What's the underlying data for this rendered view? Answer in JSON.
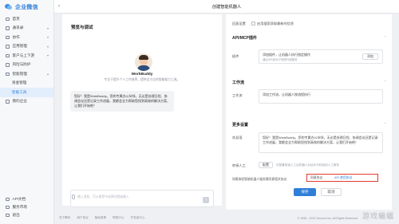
{
  "app": {
    "name": "企业微信"
  },
  "sidebar": {
    "items": [
      {
        "label": "首页",
        "icon": "home-icon"
      },
      {
        "label": "通讯录",
        "icon": "contacts-icon",
        "chev": "▾"
      },
      {
        "label": "协作",
        "icon": "collab-icon",
        "chev": "▾"
      },
      {
        "label": "应用管理",
        "icon": "apps-icon",
        "chev": "▾"
      },
      {
        "label": "客户与上下游",
        "icon": "customer-icon",
        "chev": "▾"
      },
      {
        "label": "风险与防护",
        "icon": "shield-icon"
      },
      {
        "label": "智能管理",
        "icon": "ai-icon",
        "chev": "▴"
      }
    ],
    "subitems": [
      "资金管理",
      "智能工具"
    ],
    "after": {
      "label": "我的企业",
      "icon": "company-icon"
    },
    "bottom": [
      {
        "label": "API文档",
        "icon": "doc-icon"
      },
      {
        "label": "服务市场",
        "icon": "market-icon"
      },
      {
        "label": "退出",
        "icon": "logout-icon"
      }
    ]
  },
  "header": {
    "title": "创建智能机器人",
    "back": "‹"
  },
  "preview": {
    "title": "预览与调试",
    "bot_name": "WorkBuddy",
    "bot_desc": "专注于提升个人工作效率，提供全方位的智能助力工具。",
    "greeting": "您好！我是WorkBuddy，您的专属办公伙伴。无论是处理日程、协调会议还是记录工作进展，我都会全力帮助您找到高效的解决方案，让我们开始吧！",
    "input_placeholder": "输入消息，可从推荐中选择问题或输入",
    "send": "↑"
  },
  "form": {
    "top_label": "回复设置",
    "top_option": "启用搜索获取最新的信息",
    "api_section": "API/MCP插件",
    "plugin_label": "插件",
    "plugin_value": "添加插件，让机器人执行指定操作",
    "plugin_sub": "通过API或MCP调用外部服务",
    "add_button": "添加",
    "workflow_section": "工作流",
    "workflow_label": "工作流",
    "workflow_value": "添加工作流，让机器人按流程执行",
    "more_section": "更多设置",
    "welcome_label": "欢迎语",
    "welcome_value": "您好！我是WorkBuddy，您的专属办公伙伴。无论是处理日程、协调会议还是记录工作进展，我都会全力帮助您找到高效的解决方案，让我们开始吧！",
    "transfer_label": "转接人工",
    "transfer_button": "配置",
    "transfer_hint": "可配置转接人工后机器人对话中可转接到人工服务",
    "agreement_text": "如需体验智能机器人服务需同意相关协议",
    "agreement_link_a": "同意协议",
    "agreement_link_b": "API 使用协议",
    "save": "保存",
    "cancel": "取消"
  },
  "footer": {
    "links": [
      "关于腾讯",
      "用户协议",
      "隐私政策",
      "帮助中心",
      "开发者中心"
    ],
    "copyright": "© 1998 - 2025 Tencent Inc. All Rights Reserved"
  },
  "watermark": "游戏蝙蝠"
}
